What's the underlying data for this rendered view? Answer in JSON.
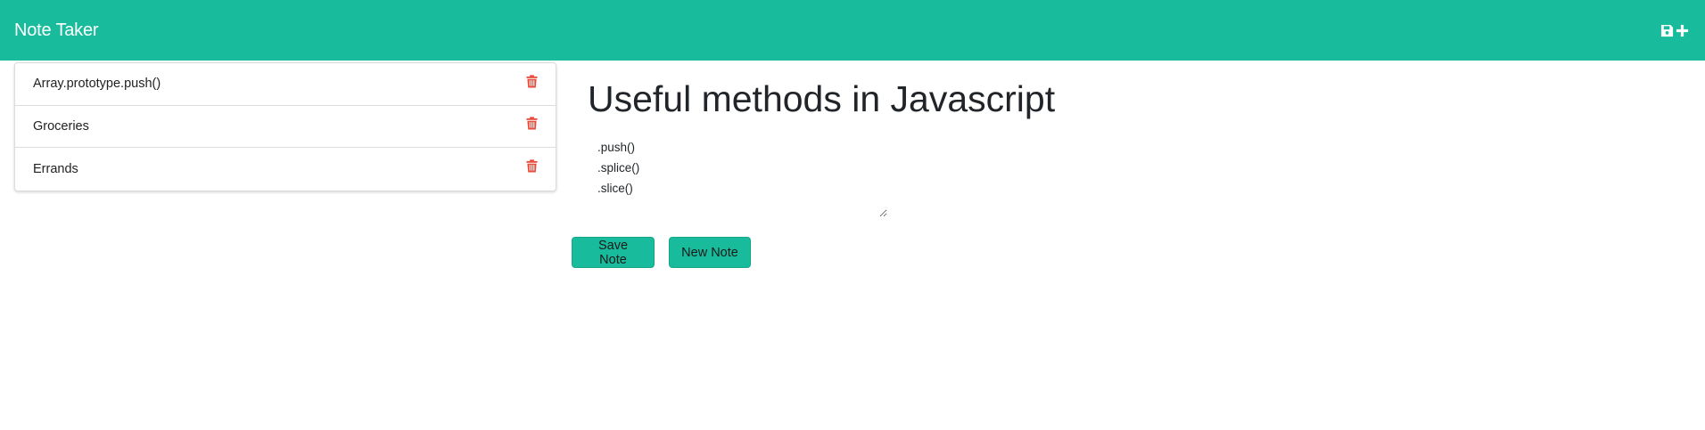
{
  "navbar": {
    "brand": "Note Taker",
    "icons": [
      "save-icon",
      "plus-icon"
    ],
    "background": "#18bc9c"
  },
  "notes": [
    {
      "title": "Array.prototype.push()"
    },
    {
      "title": "Groceries"
    },
    {
      "title": "Errands"
    }
  ],
  "active_note": {
    "title": "Useful methods in Javascript",
    "text": ".push()\n.splice()\n.slice()"
  },
  "buttons": {
    "save_label": "Save Note",
    "new_label": "New Note"
  },
  "colors": {
    "accent": "#18bc9c",
    "delete": "#e74c3c"
  }
}
